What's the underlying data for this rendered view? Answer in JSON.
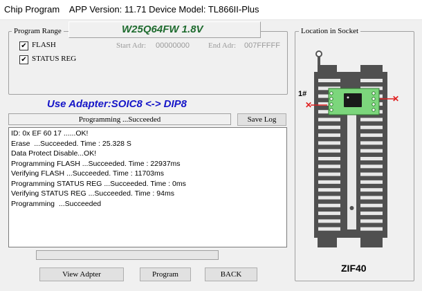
{
  "window": {
    "title": "Chip Program    APP Version: 11.71 Device Model: TL866II-Plus"
  },
  "program_range": {
    "legend": "Program Range",
    "chip_name": "W25Q64FW 1.8V",
    "flash": {
      "label": "FLASH",
      "checked": true
    },
    "status_reg": {
      "label": "STATUS REG",
      "checked": true
    },
    "start_adr_label": "Start Adr:",
    "start_adr_value": "00000000",
    "end_adr_label": "End Adr:",
    "end_adr_value": "007FFFFF"
  },
  "adapter_text": "Use Adapter:SOIC8 <-> DIP8",
  "status_text": "Programming  ...Succeeded",
  "save_log_label": "Save Log",
  "log_lines": [
    "ID: 0x EF 60 17 ......OK!",
    "Erase  ...Succeeded. Time : 25.328 S",
    "Data Protect Disable...OK!",
    "Programming FLASH ...Succeeded. Time : 22937ms",
    "Verifying FLASH ...Succeeded. Time : 11703ms",
    "Programming STATUS REG ...Succeeded. Time : 0ms",
    "Verifying STATUS REG ...Succeeded. Time : 94ms",
    "Programming  ...Succeeded"
  ],
  "progress_fraction": 0,
  "buttons": {
    "view_adapter": "View Adpter",
    "program": "Program",
    "back": "BACK"
  },
  "socket": {
    "legend": "Location in Socket",
    "pin1_label": "1#",
    "zif_label": "ZIF40"
  },
  "colors": {
    "chip_name": "#1e6b2e",
    "adapter_text": "#1515c8",
    "adapter_board": "#7cd67c",
    "pin_marker": "#e02020"
  }
}
